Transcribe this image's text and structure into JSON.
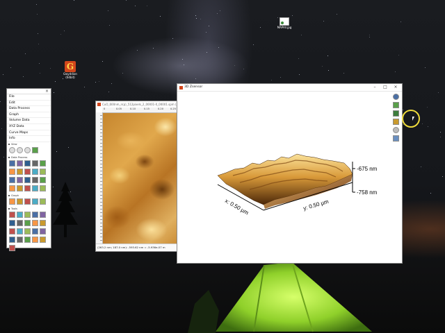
{
  "desktop": {
    "icons": [
      {
        "name": "Gwyddion",
        "sublabel": "(64bit)"
      },
      {
        "name": "MAPAll.jpg"
      }
    ]
  },
  "toolbox": {
    "menu": [
      "File",
      "Edit",
      "Data Process",
      "Graph",
      "Volume Data",
      "XYZ Data",
      "Curve Maps",
      "Info"
    ],
    "sections": [
      "View",
      "Data Process",
      "Graph",
      "Tools"
    ]
  },
  "data_window": {
    "title": "CuO_600nm_n(p)_512pixels_2_00001-0_00001.spm (Z)",
    "ruler_ticks": [
      "0",
      "0.05",
      "0.10",
      "0.15",
      "0.20",
      "0.25"
    ],
    "status": "(263.2 nm; 187.0 nm): -593.62 nm = -5.936e-07 m"
  },
  "window3d": {
    "title": "3D Zsensor",
    "labels": {
      "x_axis": "x: 0.50 µm",
      "y_axis": "y: 0.50 µm",
      "z_max": "-675 nm",
      "z_min": "-758 nm"
    }
  }
}
